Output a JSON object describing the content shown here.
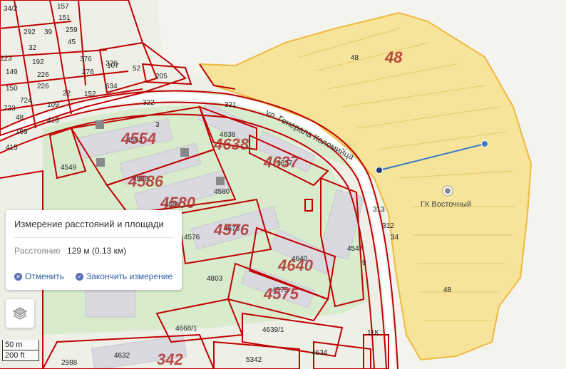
{
  "panel": {
    "title": "Измерение расстояний и площади",
    "distance_label": "Расстояние",
    "distance_value": "129 м (0.13 км)",
    "cancel_label": "Отменить",
    "finish_label": "Закончить измерение"
  },
  "scale": {
    "metric": "50 m",
    "imperial": "200 ft"
  },
  "map": {
    "street_name": "ул. Генерала Коломийца",
    "poi_name": "ГК Восточный",
    "colors": {
      "parcel_outline": "#c00000",
      "highlight_fill": "#f5e08a",
      "measure_line": "#3a78c9",
      "green_area": "#d8eccd",
      "building": "#d9d9df"
    },
    "parcel_numbers": [
      "34/2",
      "157",
      "151",
      "292",
      "39",
      "259",
      "32",
      "45",
      "376",
      "326",
      "123",
      "192",
      "276",
      "149",
      "226",
      "634",
      "52",
      "205",
      "150",
      "226",
      "152",
      "724",
      "22",
      "109",
      "723",
      "48",
      "416",
      "199",
      "415",
      "322",
      "321",
      "4554",
      "4638",
      "4637",
      "4549",
      "4586",
      "4580",
      "4580",
      "4576",
      "4576",
      "4640",
      "4547",
      "4803",
      "4575",
      "4668/1",
      "4639/1",
      "4632",
      "5342",
      "4634",
      "2988",
      "313",
      "312",
      "48",
      "48",
      "107",
      "34",
      "3",
      "9",
      "11К"
    ],
    "big_labels": [
      "48",
      "4554",
      "4638",
      "4637",
      "4586",
      "4580",
      "4576",
      "4640",
      "4575",
      "342"
    ]
  }
}
